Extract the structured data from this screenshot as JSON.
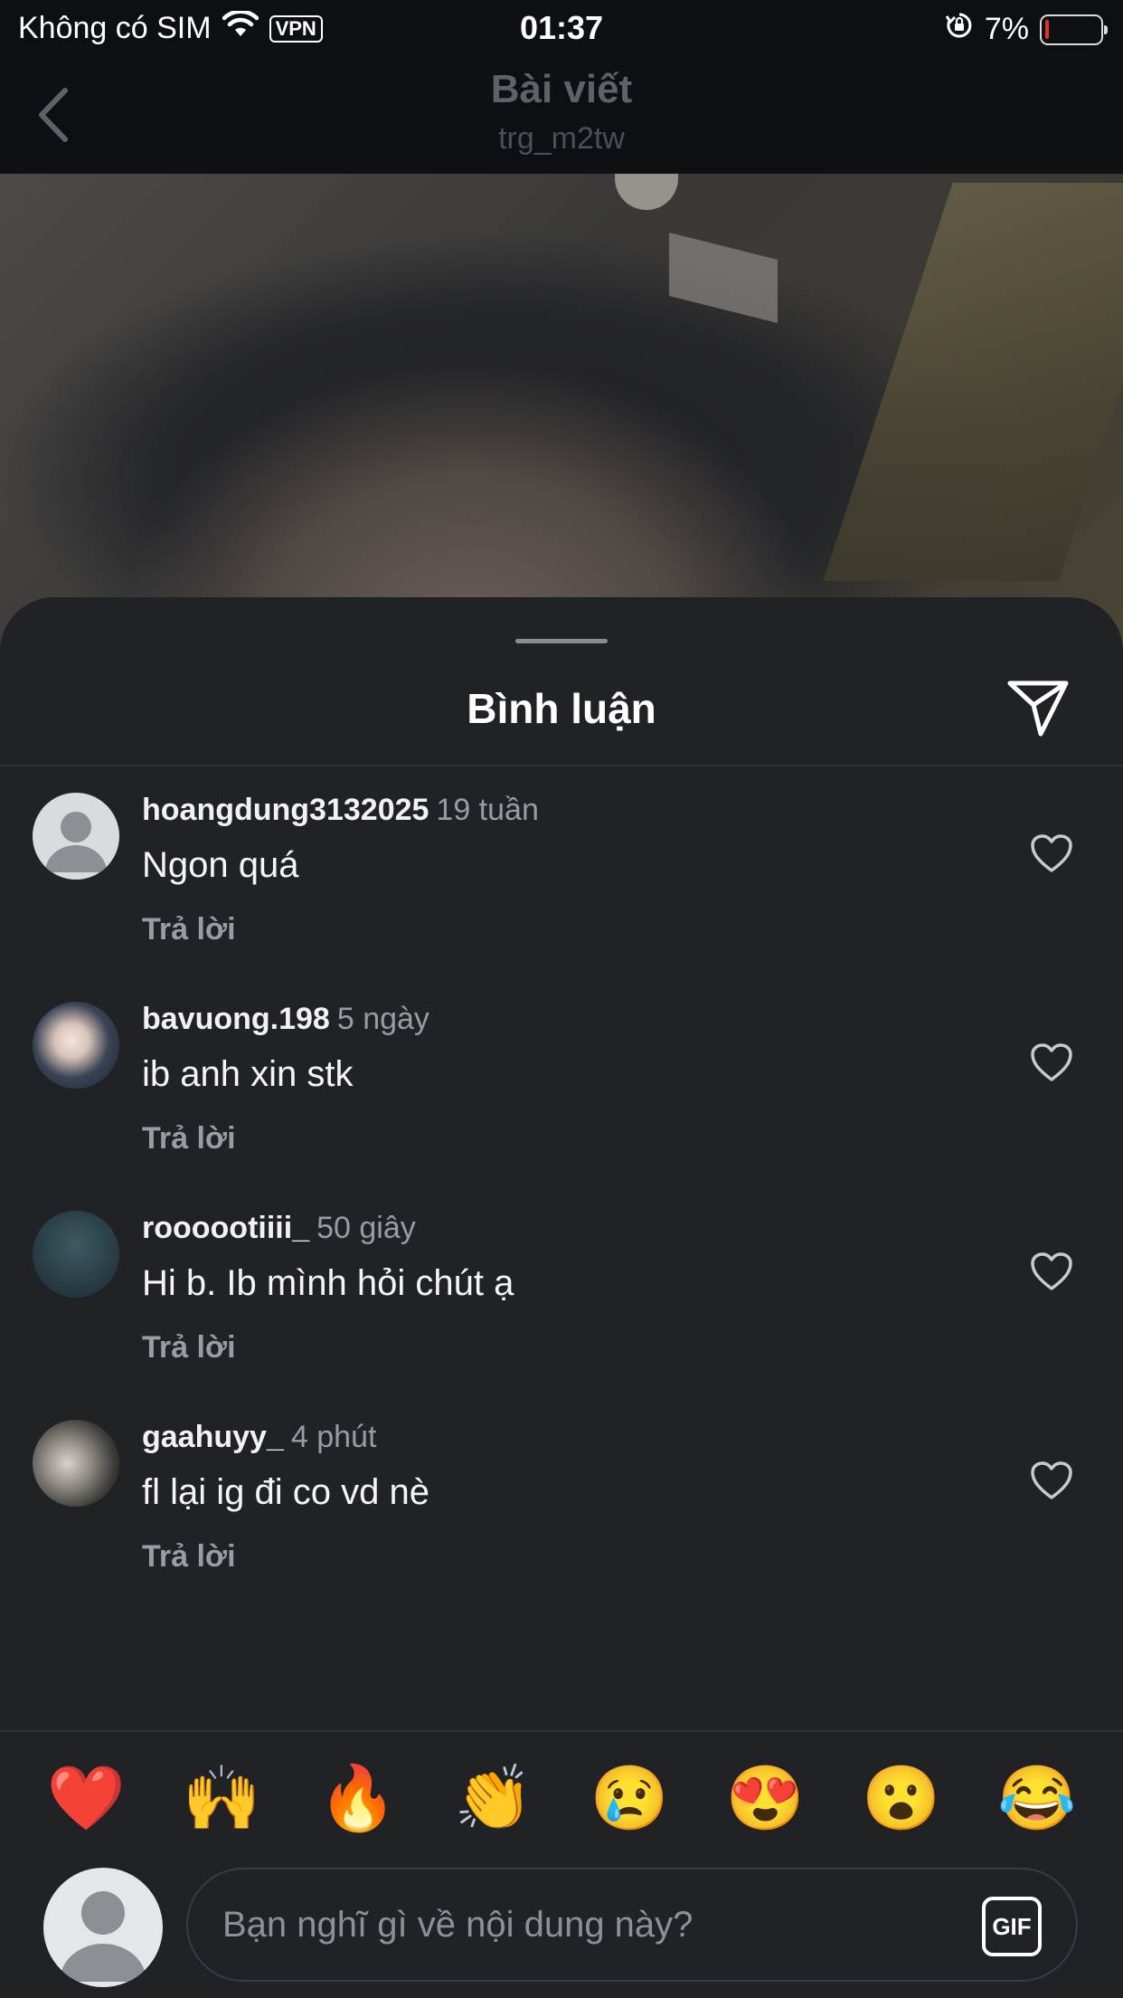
{
  "status_bar": {
    "carrier": "Không có SIM",
    "vpn": "VPN",
    "time": "01:37",
    "battery_percent": "7%",
    "battery_level": 0.07,
    "icons": [
      "wifi-icon",
      "orientation-lock-icon",
      "battery-icon"
    ]
  },
  "header": {
    "title": "Bài viết",
    "subtitle": "trg_m2tw",
    "back_icon": "chevron-left-icon"
  },
  "sheet": {
    "title": "Bình luận",
    "share_icon": "paper-plane-icon"
  },
  "comments": [
    {
      "username": "hoangdung3132025",
      "time": "19 tuần",
      "text": "Ngon quá",
      "reply": "Trả lời",
      "avatar": "default"
    },
    {
      "username": "bavuong.198",
      "time": "5 ngày",
      "text": "ib anh xin stk",
      "reply": "Trả lời",
      "avatar": "photo"
    },
    {
      "username": "roooootiiii_",
      "time": "50 giây",
      "text": "Hi b. Ib mình hỏi chút ạ",
      "reply": "Trả lời",
      "avatar": "photo"
    },
    {
      "username": "gaahuyy_",
      "time": "4 phút",
      "text": "fl lại ig đi co vd nè",
      "reply": "Trả lời",
      "avatar": "photo"
    }
  ],
  "reactions": [
    "❤️",
    "🙌",
    "🔥",
    "👏",
    "😢",
    "😍",
    "😮",
    "😂"
  ],
  "input": {
    "placeholder": "Bạn nghĩ gì về nội dung này?",
    "gif_label": "GIF"
  },
  "colors": {
    "sheet_bg": "#212226",
    "status_bg": "#0d0f12",
    "muted_text": "#9a9ca1",
    "battery_low": "#ff3b30"
  }
}
